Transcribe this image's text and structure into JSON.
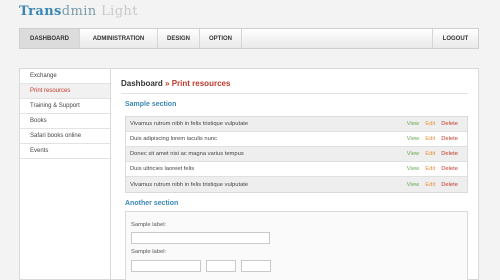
{
  "logo": {
    "part1": "Trans",
    "part2": "dmin",
    "part3": "Light"
  },
  "nav": {
    "items": [
      "DASHBOARD",
      "ADMINISTRATION",
      "DESIGN",
      "OPTION"
    ],
    "active": "DASHBOARD",
    "logout": "LOGOUT"
  },
  "sidebar": {
    "items": [
      "Exchange",
      "Print resources",
      "Training & Support",
      "Books",
      "Safari books online",
      "Events"
    ],
    "active": "Print resources"
  },
  "main": {
    "breadcrumb": {
      "root": "Dashboard",
      "separator": "»",
      "current": "Print resources"
    },
    "sample_section": {
      "title": "Sample section",
      "rows": [
        "Vivamus rutrum nibh in felis tristique vulputate",
        "Duis adipiscing lorem iaculis nunc",
        "Donec sit amet nisi ac magna varius tempus",
        "Duis ultricies laoreet felis",
        "Vivamus rutrum nibh in felis tristique vulputate"
      ],
      "actions": {
        "view": "View",
        "edit": "Edit",
        "delete": "Delete"
      }
    },
    "another_section": {
      "title": "Another section",
      "label1": "Sample label:",
      "label2": "Sample label:",
      "input1_value": "",
      "input2_value": "",
      "input3_value": "",
      "input4_value": ""
    }
  },
  "colors": {
    "accent_blue": "#3a87b5",
    "accent_red": "#c0392b",
    "view_green": "#6aa84f",
    "edit_orange": "#e69138"
  }
}
